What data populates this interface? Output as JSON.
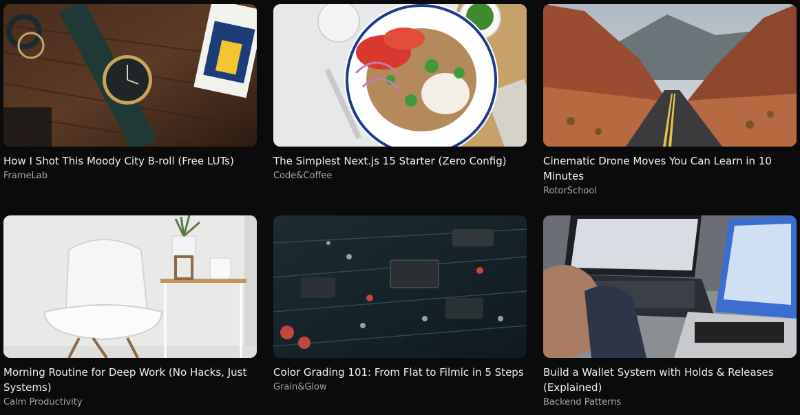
{
  "videos": [
    {
      "title": "How I Shot This Moody City B-roll (Free LUTs)",
      "channel": "FrameLab",
      "thumbnail": "watch-on-wood-thumbnail"
    },
    {
      "title": "The Simplest Next.js 15 Starter (Zero Config)",
      "channel": "Code&Coffee",
      "thumbnail": "salad-plate-thumbnail"
    },
    {
      "title": "Cinematic Drone Moves You Can Learn in 10 Minutes",
      "channel": "RotorSchool",
      "thumbnail": "desert-road-thumbnail"
    },
    {
      "title": "Morning Routine for Deep Work (No Hacks, Just Systems)",
      "channel": "Calm Productivity",
      "thumbnail": "white-chair-thumbnail"
    },
    {
      "title": "Color Grading 101: From Flat to Filmic in 5 Steps",
      "channel": "Grain&Glow",
      "thumbnail": "circuit-board-thumbnail"
    },
    {
      "title": "Build a Wallet System with Holds & Releases (Explained)",
      "channel": "Backend Patterns",
      "thumbnail": "laptops-typing-thumbnail"
    }
  ]
}
